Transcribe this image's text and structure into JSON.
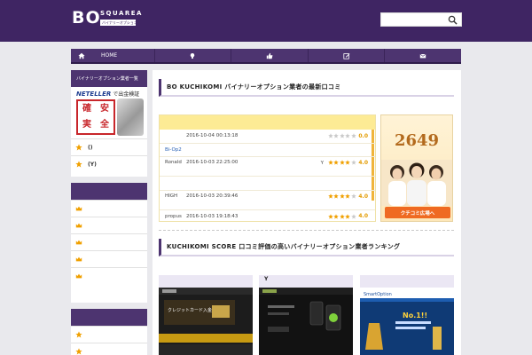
{
  "header": {
    "logo_main": "BO",
    "logo_sub": "SQUAREA",
    "logo_tag": "バイナリーオプション比較",
    "search_placeholder": ""
  },
  "nav": {
    "home_label": "HOME",
    "items": [
      "lightbulb-icon",
      "thumbs-up-icon",
      "edit-icon",
      "mail-icon"
    ]
  },
  "sidebar": {
    "box1_title": "バイナリーオプション業者一覧",
    "banner_brand": "NETELLER",
    "banner_text": "で出金検証",
    "stamp_chars": [
      "確",
      "安",
      "実",
      "全"
    ],
    "box1_items": [
      {
        "label": "()"
      },
      {
        "label": "(Y)"
      }
    ],
    "box2_item_count": 5,
    "box3_item_count": 2
  },
  "main": {
    "section1_title": "BO KUCHIKOMI バイナリーオプション業者の最新口コミ",
    "reviews": [
      {
        "who": "",
        "date": "2016-10-04 00:13:18",
        "y": "",
        "score": "0.0",
        "stars": 0
      },
      {
        "link": "Bi-Op2"
      },
      {
        "who": "Ronald",
        "date": "2016-10-03 22:25:00",
        "y": "Y",
        "score": "4.0",
        "stars": 4
      },
      {
        "who": "HIGH",
        "date": "2016-10-03 20:39:46",
        "y": "",
        "score": "4.0",
        "stars": 4
      },
      {
        "who": "propus",
        "date": "2016-10-03 19:18:43",
        "y": "",
        "score": "4.0",
        "stars": 4
      }
    ],
    "ad_number": "2649",
    "ad_button": "クチコミ広場へ",
    "section2_title": "KUCHIKOMI SCORE 口コミ評価の高いバイナリーオプション業者ランキング",
    "thumbs": [
      {
        "title": ""
      },
      {
        "title": "Y"
      },
      {
        "title": ""
      }
    ],
    "thumb_text": {
      "t1_banner": "クレジットカード入金",
      "t3_brand": "SmartOption",
      "t3_badge": "No.1!!"
    }
  },
  "colors": {
    "header_bg": "#3f2563",
    "nav_bg": "#4d3470",
    "star": "#f0a000",
    "crown": "#f0a000"
  }
}
